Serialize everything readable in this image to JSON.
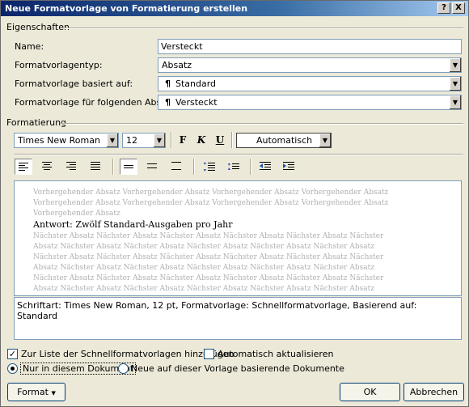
{
  "window": {
    "title": "Neue Formatvorlage von Formatierung erstellen",
    "help_button": "?",
    "close_button": "X"
  },
  "properties": {
    "group_label": "Eigenschaften",
    "name_label": "Name:",
    "name_value": "Versteckt",
    "type_label": "Formatvorlagentyp:",
    "type_value": "Absatz",
    "based_on_label": "Formatvorlage basiert auf:",
    "based_on_value": "Standard",
    "following_label": "Formatvorlage für folgenden Absatz:",
    "following_value": "Versteckt",
    "para_mark": "¶"
  },
  "formatting": {
    "group_label": "Formatierung",
    "font": "Times New Roman",
    "size": "12",
    "bold_label": "F",
    "italic_label": "K",
    "underline_label": "U",
    "color": "Automatisch"
  },
  "preview": {
    "previous_lines": [
      "Vorhergehender Absatz Vorhergehender Absatz Vorhergehender Absatz Vorhergehender Absatz",
      "Vorhergehender Absatz Vorhergehender Absatz Vorhergehender Absatz Vorhergehender Absatz",
      "Vorhergehender Absatz"
    ],
    "current": "Antwort: Zwölf Standard-Ausgaben pro Jahr",
    "next_lines": [
      "Nächster Absatz Nächster Absatz Nächster Absatz Nächster Absatz Nächster Absatz Nächster",
      "Absatz Nächster Absatz Nächster Absatz Nächster Absatz Nächster Absatz Nächster Absatz",
      "Nächster Absatz Nächster Absatz Nächster Absatz Nächster Absatz Nächster Absatz Nächster",
      "Absatz Nächster Absatz Nächster Absatz Nächster Absatz Nächster Absatz Nächster Absatz",
      "Nächster Absatz Nächster Absatz Nächster Absatz Nächster Absatz Nächster Absatz Nächster",
      "Absatz Nächster Absatz Nächster Absatz Nächster Absatz Nächster Absatz Nächster Absatz"
    ]
  },
  "description": "Schriftart: Times New Roman, 12 pt, Formatvorlage: Schnellformatvorlage, Basierend auf: Standard",
  "options": {
    "add_to_quick_styles": "Zur Liste der Schnellformatvorlagen hinzufügen",
    "add_to_quick_styles_checked": true,
    "auto_update": "Automatisch aktualisieren",
    "auto_update_checked": false,
    "only_this_document": "Nur in diesem Dokument",
    "new_documents": "Neue auf dieser Vorlage basierende Dokumente",
    "selected_scope": "only_this_document"
  },
  "buttons": {
    "format": "Format",
    "ok": "OK",
    "cancel": "Abbrechen"
  }
}
